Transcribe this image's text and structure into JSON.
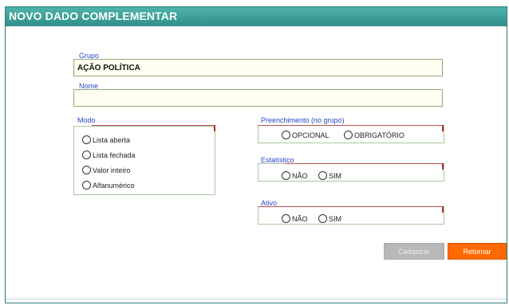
{
  "window": {
    "title": "NOVO DADO COMPLEMENTAR"
  },
  "grupo": {
    "label": "Grupo",
    "value": "AÇÃO POLÍTICA"
  },
  "nome": {
    "label": "Nome",
    "value": ""
  },
  "modo": {
    "label": "Modo",
    "options": [
      "Lista aberta",
      "Lista fechada",
      "Valor inteiro",
      "Alfanumérico"
    ]
  },
  "preenchimento": {
    "label": "Preenchimento (no grupo)",
    "options": [
      "OPCIONAL",
      "OBRIGATÓRIO"
    ]
  },
  "estatistico": {
    "label": "Estatístico",
    "options": [
      "NÃO",
      "SIM"
    ]
  },
  "ativo": {
    "label": "Ativo",
    "options": [
      "NÃO",
      "SIM"
    ]
  },
  "actions": {
    "cadastrar": "Cadastrar",
    "retornar": "Retornar"
  },
  "colors": {
    "title_bar": "#3aa39c",
    "label_blue": "#2747c8",
    "primary_button": "#ff6a00",
    "disabled_button": "#b8b8b8"
  }
}
